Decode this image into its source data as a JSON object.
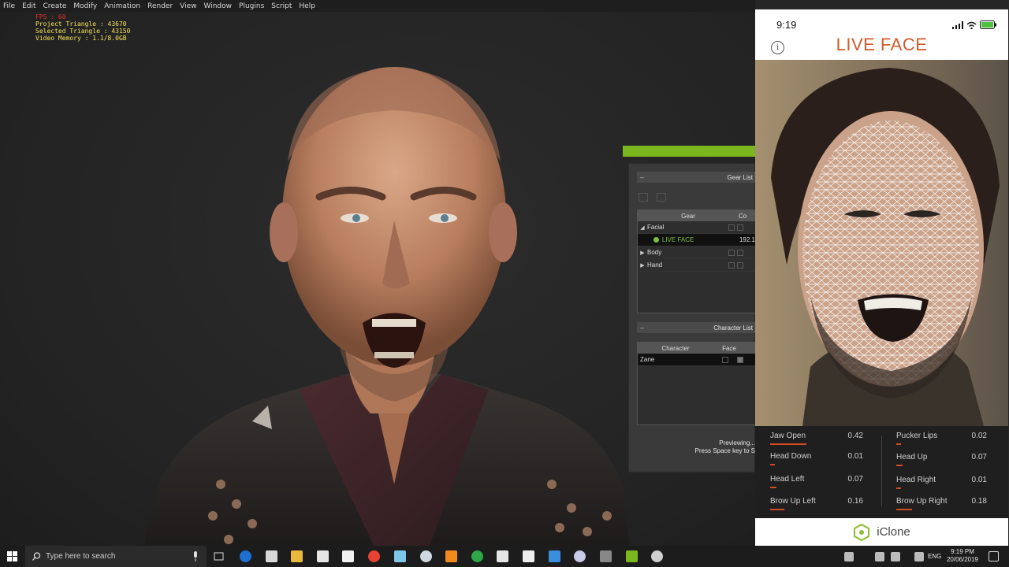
{
  "menu": [
    "File",
    "Edit",
    "Create",
    "Modify",
    "Animation",
    "Render",
    "View",
    "Window",
    "Plugins",
    "Script",
    "Help"
  ],
  "stats": {
    "fps": "FPS : 60",
    "project_triangle": "Project Triangle : 43670",
    "selected_triangle": "Selected Triangle : 43150",
    "video_memory": "Video Memory : 1.1/8.0GB"
  },
  "gear_panel": {
    "title": "Gear List",
    "col_gear": "Gear",
    "col_co": "Co",
    "rows": [
      {
        "label": "Facial",
        "arrow": "◢"
      },
      {
        "label": "LIVE FACE",
        "value": "192.1"
      },
      {
        "label": "Body",
        "arrow": "▶"
      },
      {
        "label": "Hand",
        "arrow": "▶"
      }
    ]
  },
  "character_panel": {
    "title": "Character List",
    "col_character": "Character",
    "col_face": "Face",
    "rows": [
      {
        "label": "Zane"
      }
    ]
  },
  "preview": {
    "line1": "Previewing...",
    "line2": "Press Space key to S"
  },
  "phone": {
    "time": "9:19",
    "title": "LIVE FACE",
    "info_icon": "i",
    "metrics_left": [
      {
        "label": "Jaw Open",
        "value": "0.42",
        "level": 0.42
      },
      {
        "label": "Head Down",
        "value": "0.01",
        "level": 0.01
      },
      {
        "label": "Head Left",
        "value": "0.07",
        "level": 0.07
      },
      {
        "label": "Brow Up Left",
        "value": "0.16",
        "level": 0.16
      }
    ],
    "metrics_right": [
      {
        "label": "Pucker Lips",
        "value": "0.02",
        "level": 0.02
      },
      {
        "label": "Head Up",
        "value": "0.07",
        "level": 0.07
      },
      {
        "label": "Head Right",
        "value": "0.01",
        "level": 0.01
      },
      {
        "label": "Brow Up Right",
        "value": "0.18",
        "level": 0.18
      }
    ],
    "brand": "iClone"
  },
  "taskbar": {
    "search_placeholder": "Type here to search",
    "language": "ENG",
    "time": "9:19 PM",
    "date": "20/06/2019"
  },
  "colors": {
    "accent_green": "#7bb61e",
    "live_face_orange": "#d15b2c",
    "metric_bar": "#d04a22"
  }
}
